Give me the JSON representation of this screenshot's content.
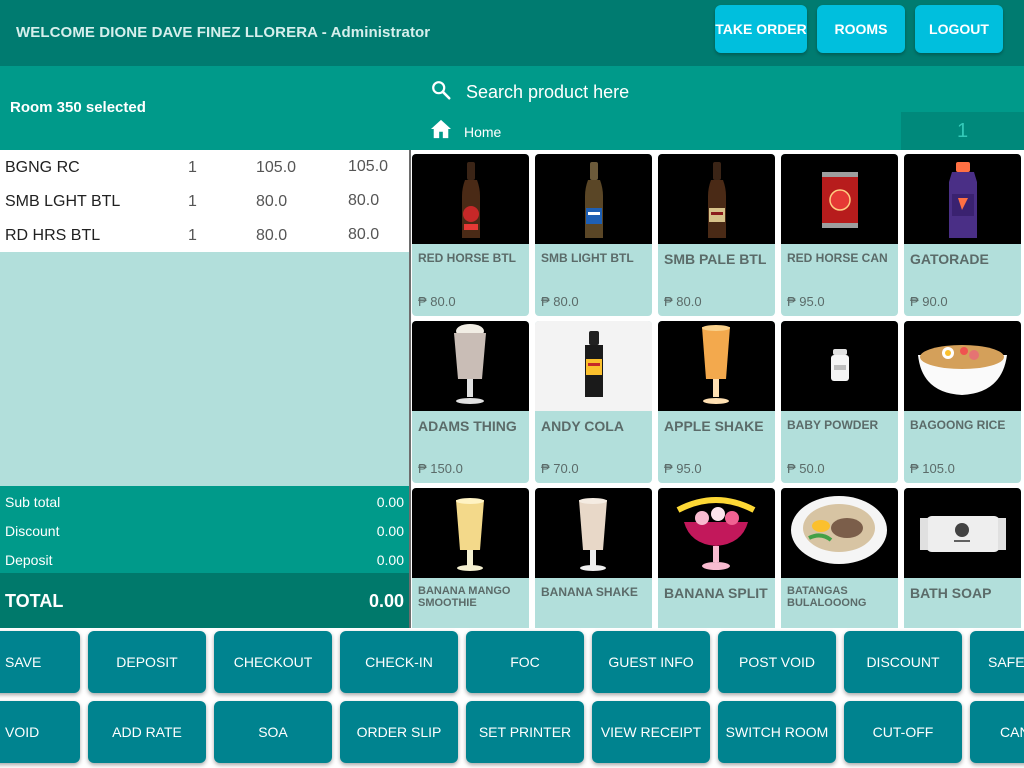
{
  "topbar": {
    "welcome": "WELCOME DIONE DAVE FINEZ LLORERA - Administrator",
    "buttons": [
      "TAKE ORDER",
      "ROOMS",
      "LOGOUT"
    ]
  },
  "header": {
    "room_selected": "Room 350 selected",
    "search_placeholder": "Search product here",
    "breadcrumb": "Home",
    "page_number": "1"
  },
  "order": {
    "rows": [
      {
        "name": "BGNG RC",
        "qty": "1",
        "price": "105.0",
        "total": "105.0"
      },
      {
        "name": "SMB LGHT BTL",
        "qty": "1",
        "price": "80.0",
        "total": "80.0"
      },
      {
        "name": "RD HRS BTL",
        "qty": "1",
        "price": "80.0",
        "total": "80.0"
      }
    ]
  },
  "totals": {
    "subtotal_label": "Sub total",
    "subtotal": "0.00",
    "discount_label": "Discount",
    "discount": "0.00",
    "deposit_label": "Deposit",
    "deposit": "0.00",
    "total_label": "TOTAL",
    "total": "0.00"
  },
  "products": [
    {
      "name": "RED HORSE BTL",
      "price": "₱ 80.0",
      "icon": "beer-bottle-icon"
    },
    {
      "name": "SMB LIGHT BTL",
      "price": "₱ 80.0",
      "icon": "beer-bottle-icon"
    },
    {
      "name": "SMB PALE BTL",
      "price": "₱ 80.0",
      "icon": "beer-bottle-icon"
    },
    {
      "name": "RED HORSE CAN",
      "price": "₱ 95.0",
      "icon": "beer-can-icon"
    },
    {
      "name": "GATORADE",
      "price": "₱ 90.0",
      "icon": "sports-drink-icon"
    },
    {
      "name": "ADAMS THING",
      "price": "₱ 150.0",
      "icon": "shake-glass-icon"
    },
    {
      "name": "ANDY COLA",
      "price": "₱ 70.0",
      "icon": "cola-bottle-icon"
    },
    {
      "name": "APPLE SHAKE",
      "price": "₱ 95.0",
      "icon": "shake-glass-icon"
    },
    {
      "name": "BABY POWDER",
      "price": "₱ 50.0",
      "icon": "powder-bottle-icon"
    },
    {
      "name": "BAGOONG RICE",
      "price": "₱ 105.0",
      "icon": "rice-bowl-icon"
    },
    {
      "name": "BANANA MANGO SMOOTHIE",
      "price": "",
      "icon": "shake-glass-icon"
    },
    {
      "name": "BANANA SHAKE",
      "price": "",
      "icon": "shake-glass-icon"
    },
    {
      "name": "BANANA SPLIT",
      "price": "",
      "icon": "dessert-cup-icon"
    },
    {
      "name": "BATANGAS BULALOOONG",
      "price": "",
      "icon": "soup-bowl-icon"
    },
    {
      "name": "BATH SOAP",
      "price": "",
      "icon": "soap-bar-icon"
    }
  ],
  "actions": {
    "row1": [
      "SAVE",
      "DEPOSIT",
      "CHECKOUT",
      "CHECK-IN",
      "FOC",
      "GUEST INFO",
      "POST VOID",
      "DISCOUNT",
      "SAFEK"
    ],
    "row2": [
      "VOID",
      "ADD RATE",
      "SOA",
      "ORDER SLIP",
      "SET PRINTER",
      "VIEW RECEIPT",
      "SWITCH ROOM",
      "CUT-OFF",
      "CAN"
    ]
  },
  "colors": {
    "topbar": "#007b70",
    "header": "#009a8a",
    "accent_button": "#00bfdd",
    "action_button": "#00838f",
    "card": "#b2dfdb"
  }
}
